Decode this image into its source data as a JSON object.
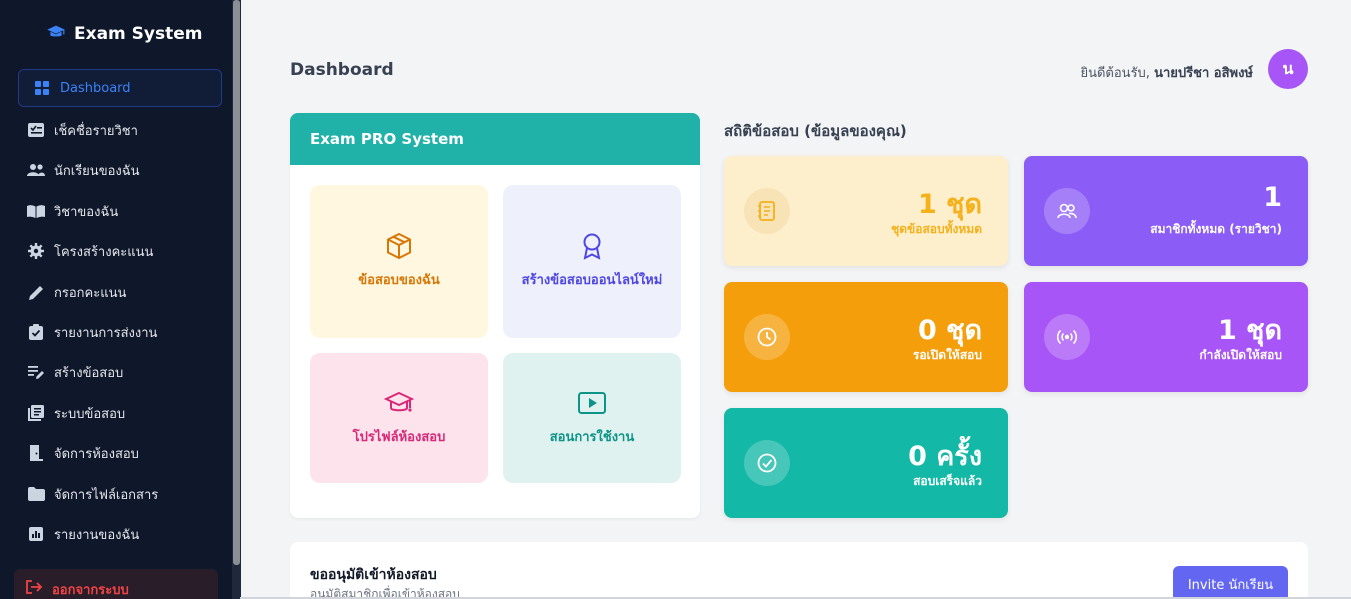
{
  "brand": {
    "title": "Exam System"
  },
  "sidebar": {
    "items": [
      {
        "label": "Dashboard",
        "icon": "grid-icon",
        "active": true
      },
      {
        "label": "เช็คชื่อรายวิชา",
        "icon": "checklist-icon"
      },
      {
        "label": "นักเรียนของฉัน",
        "icon": "users-icon"
      },
      {
        "label": "วิชาของฉัน",
        "icon": "book-icon"
      },
      {
        "label": "โครงสร้างคะแนน",
        "icon": "gear-icon"
      },
      {
        "label": "กรอกคะแนน",
        "icon": "pencil-icon"
      },
      {
        "label": "รายงานการส่งงาน",
        "icon": "clipboard-check-icon"
      },
      {
        "label": "สร้างข้อสอบ",
        "icon": "edit-list-icon"
      },
      {
        "label": "ระบบข้อสอบ",
        "icon": "library-icon"
      },
      {
        "label": "จัดการห้องสอบ",
        "icon": "door-icon"
      },
      {
        "label": "จัดการไฟล์เอกสาร",
        "icon": "folder-icon"
      },
      {
        "label": "รายงานของฉัน",
        "icon": "chart-icon"
      }
    ],
    "logout_label": "ออกจากระบบ"
  },
  "header": {
    "title": "Dashboard",
    "welcome_prefix": "ยินดีต้อนรับ,",
    "user_name": "นายปรีชา อสิพงษ์",
    "avatar_letter": "น"
  },
  "pro": {
    "title": "Exam PRO System",
    "tiles": [
      {
        "label": "ข้อสอบของฉัน",
        "icon": "box-icon",
        "bg": "#fff7e0",
        "color": "#d97706"
      },
      {
        "label": "สร้างข้อสอบออนไลน์ใหม่",
        "icon": "award-icon",
        "bg": "#eef0fc",
        "color": "#4f46e5"
      },
      {
        "label": "โปรไฟล์ห้องสอบ",
        "icon": "graduation-cap-icon",
        "bg": "#fde4ec",
        "color": "#db2777"
      },
      {
        "label": "สอนการใช้งาน",
        "icon": "play-icon",
        "bg": "#e0f2ef",
        "color": "#0d9488"
      }
    ]
  },
  "stats": {
    "title": "สถิติข้อสอบ (ข้อมูลของคุณ)",
    "cards": [
      {
        "value": "1 ชุด",
        "label": "ชุดข้อสอบทั้งหมด",
        "icon": "notebook-icon",
        "bg": "#fdefcc",
        "color": "#f5b01a"
      },
      {
        "value": "1",
        "label": "สมาชิกทั้งหมด (รายวิชา)",
        "icon": "users-icon",
        "bg": "#8b5cf6",
        "color": "#ffffff"
      },
      {
        "value": "0 ชุด",
        "label": "รอเปิดให้สอบ",
        "icon": "clock-icon",
        "bg": "#f59e0b",
        "color": "#ffffff"
      },
      {
        "value": "1 ชุด",
        "label": "กำลังเปิดให้สอบ",
        "icon": "broadcast-icon",
        "bg": "#a855f7",
        "color": "#ffffff"
      },
      {
        "value": "0 ครั้ง",
        "label": "สอบเสร็จแล้ว",
        "icon": "check-circle-icon",
        "bg": "#14b8a6",
        "color": "#ffffff"
      }
    ]
  },
  "approve": {
    "title": "ขออนุมัติเข้าห้องสอบ",
    "subtitle": "อนุมัติสมาชิกเพื่อเข้าห้องสอบ",
    "invite_label": "Invite นักเรียน"
  }
}
